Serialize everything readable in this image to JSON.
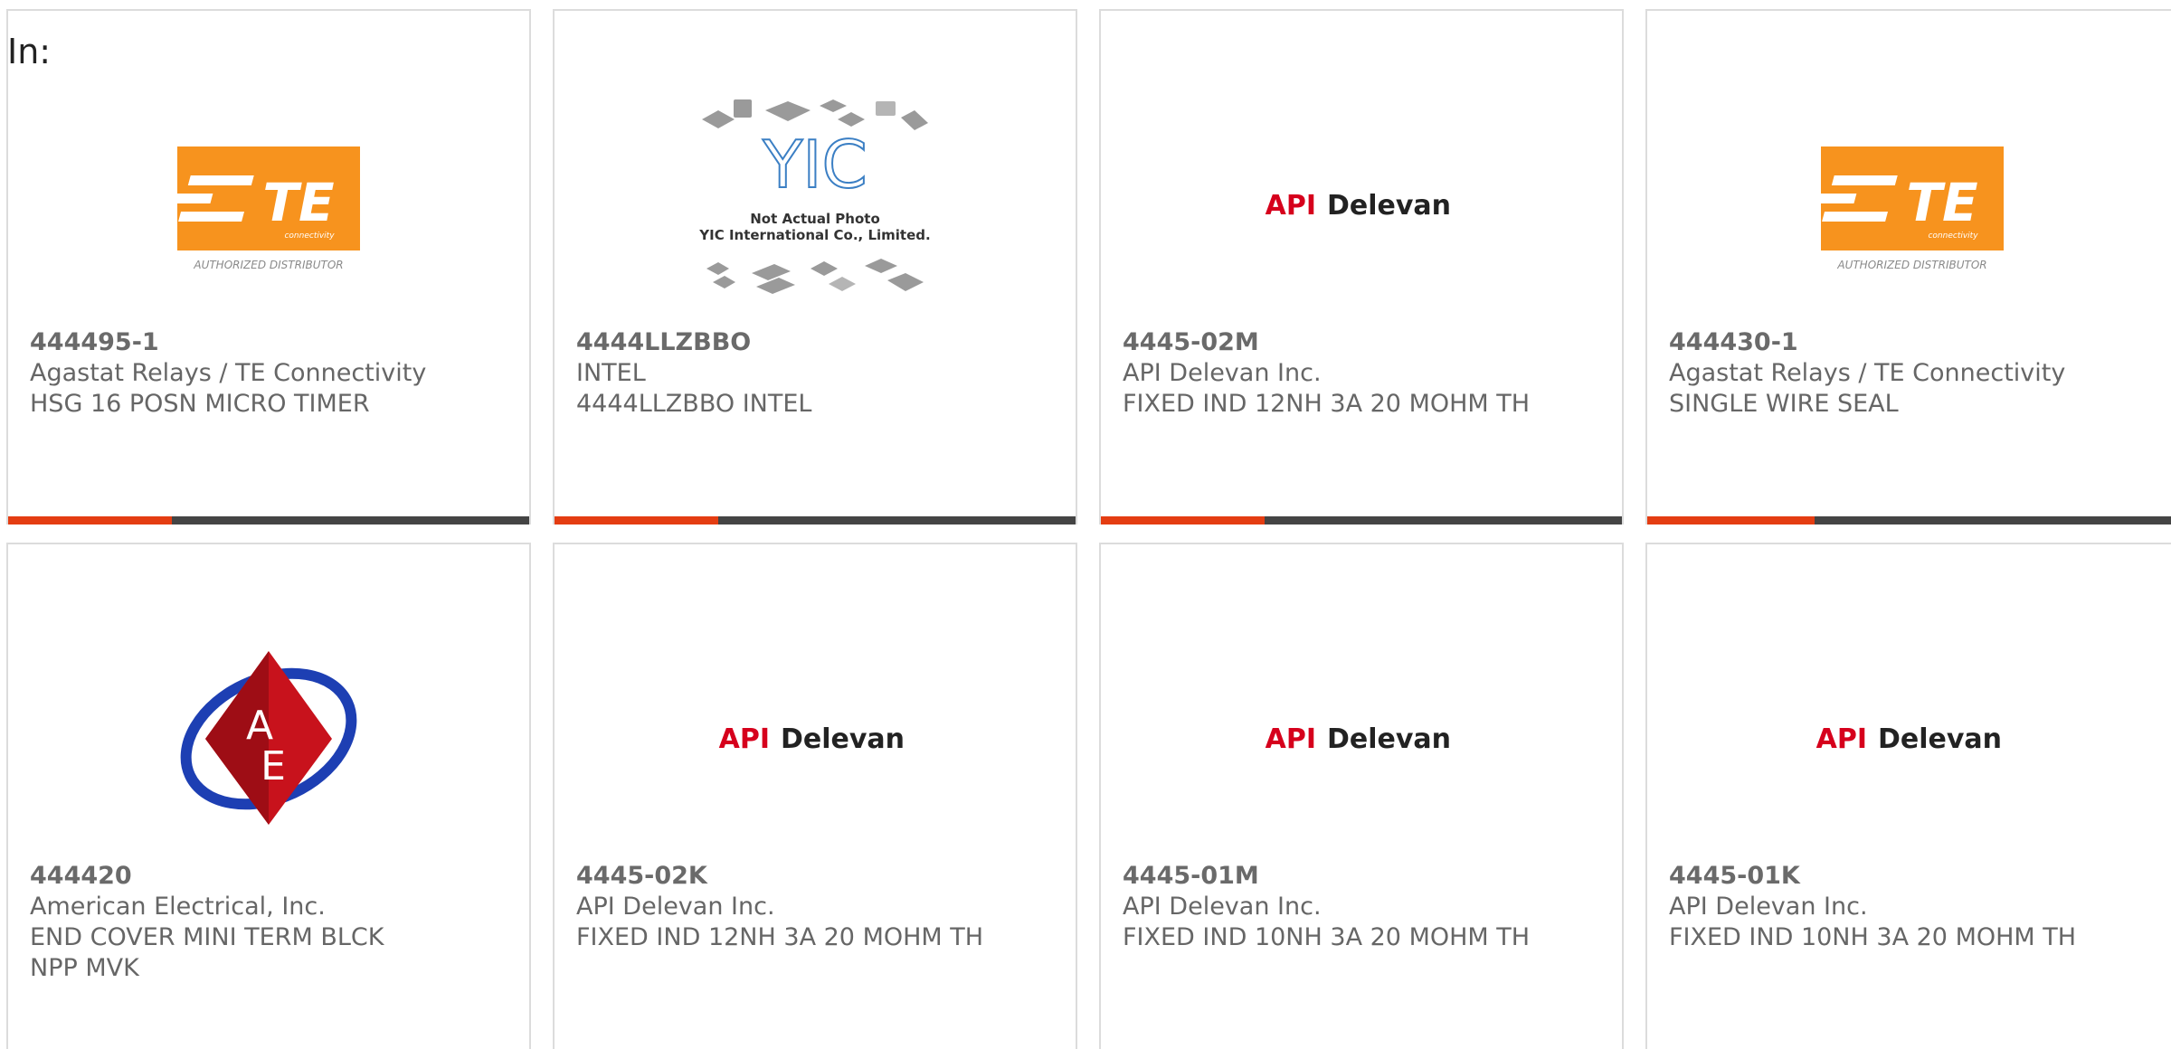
{
  "header": {
    "label": "In:"
  },
  "colors": {
    "accent": "#e43d12",
    "bar": "#444444",
    "te_orange": "#f7931e",
    "api_red": "#d6001c"
  },
  "cards": [
    {
      "part": "444495-1",
      "manufacturer": "Agastat Relays / TE Connectivity",
      "desc": "HSG 16 POSN MICRO TIMER",
      "desc2": "",
      "logo": "te-connectivity-logo",
      "logo_sub": "AUTHORIZED DISTRIBUTOR",
      "logo_tag": "connectivity",
      "logo_text": "TE"
    },
    {
      "part": "4444LLZBBO",
      "manufacturer": "INTEL",
      "desc": "4444LLZBBO INTEL",
      "desc2": "",
      "logo": "yic-placeholder-logo",
      "logo_text": "YIC",
      "logo_line1": "Not Actual Photo",
      "logo_line2": "YIC International Co., Limited."
    },
    {
      "part": "4445-02M",
      "manufacturer": "API Delevan Inc.",
      "desc": "FIXED IND 12NH 3A 20 MOHM TH",
      "desc2": "",
      "logo": "api-delevan-logo",
      "logo_a": "API",
      "logo_b": "Delevan"
    },
    {
      "part": "444430-1",
      "manufacturer": "Agastat Relays / TE Connectivity",
      "desc": "SINGLE WIRE SEAL",
      "desc2": "",
      "logo": "te-connectivity-logo",
      "logo_sub": "AUTHORIZED DISTRIBUTOR",
      "logo_tag": "connectivity",
      "logo_text": "TE"
    },
    {
      "part": "444420",
      "manufacturer": "American Electrical, Inc.",
      "desc": "END COVER MINI TERM BLCK",
      "desc2": "NPP MVK",
      "logo": "american-electrical-logo",
      "logo_a": "A",
      "logo_b": "E"
    },
    {
      "part": "4445-02K",
      "manufacturer": "API Delevan Inc.",
      "desc": "FIXED IND 12NH 3A 20 MOHM TH",
      "desc2": "",
      "logo": "api-delevan-logo",
      "logo_a": "API",
      "logo_b": "Delevan"
    },
    {
      "part": "4445-01M",
      "manufacturer": "API Delevan Inc.",
      "desc": "FIXED IND 10NH 3A 20 MOHM TH",
      "desc2": "",
      "logo": "api-delevan-logo",
      "logo_a": "API",
      "logo_b": "Delevan"
    },
    {
      "part": "4445-01K",
      "manufacturer": "API Delevan Inc.",
      "desc": "FIXED IND 10NH 3A 20 MOHM TH",
      "desc2": "",
      "logo": "api-delevan-logo",
      "logo_a": "API",
      "logo_b": "Delevan"
    }
  ]
}
